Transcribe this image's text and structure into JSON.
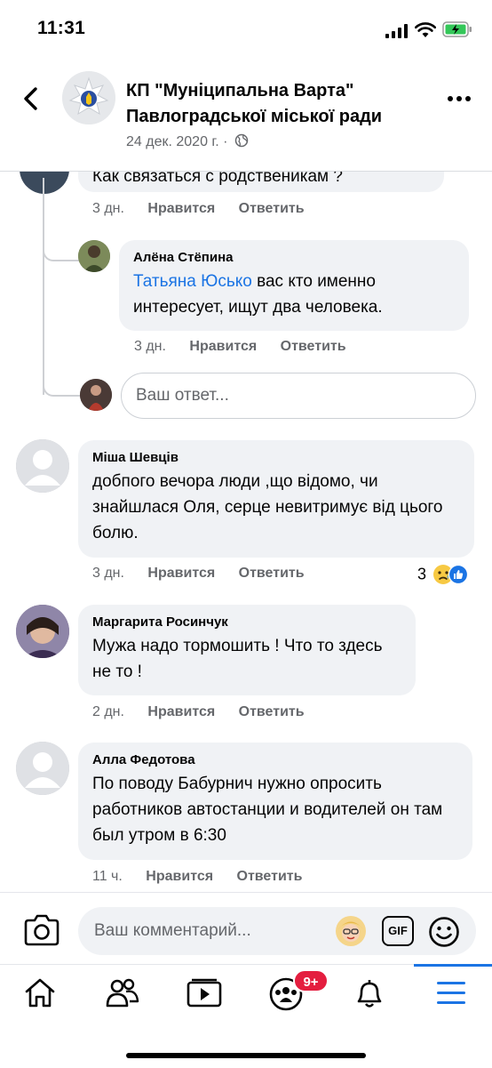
{
  "status_bar": {
    "time": "11:31"
  },
  "header": {
    "page_name": "КП \"Муніципальна Варта\" Павлоградської міської ради",
    "date": "24 дек. 2020 г. ·",
    "icons": {
      "back": "chevron-left-icon",
      "privacy": "globe-icon",
      "more": "more-horizontal-icon"
    }
  },
  "partial_comment": {
    "text": "Как связаться с родственикам ?",
    "time": "3 дн.",
    "like": "Нравится",
    "reply": "Ответить"
  },
  "reply_comment": {
    "author": "Алёна Стёпина",
    "mention": "Татьяна Юсько",
    "text": " вас кто именно интересует, ищут два человека.",
    "time": "3 дн.",
    "like": "Нравится",
    "reply": "Ответить"
  },
  "reply_input": {
    "placeholder": "Ваш ответ..."
  },
  "comments": [
    {
      "author": "Міша Шевців",
      "text": "добпого вечора люди ,що відомо, чи знайшлася Оля, серце невитримує від цього болю.",
      "time": "3 дн.",
      "like": "Нравится",
      "reply": "Ответить",
      "reactions_count": "3"
    },
    {
      "author": "Маргарита Росинчук",
      "text": "Мужа надо тормошить ! Что то здесь не то !",
      "time": "2 дн.",
      "like": "Нравится",
      "reply": "Ответить"
    },
    {
      "author": "Алла Федотова",
      "text": "По поводу Бабурнич нужно опросить работников автостанции и водителей он там был утром в 6:30",
      "time": "11 ч.",
      "like": "Нравится",
      "reply": "Ответить"
    }
  ],
  "composer": {
    "placeholder": "Ваш комментарий...",
    "gif_label": "GIF"
  },
  "tabbar": {
    "groups_badge": "9+"
  },
  "colors": {
    "accent": "#1b74e4",
    "bubble": "#f0f2f5",
    "badge": "#e41e3f"
  }
}
